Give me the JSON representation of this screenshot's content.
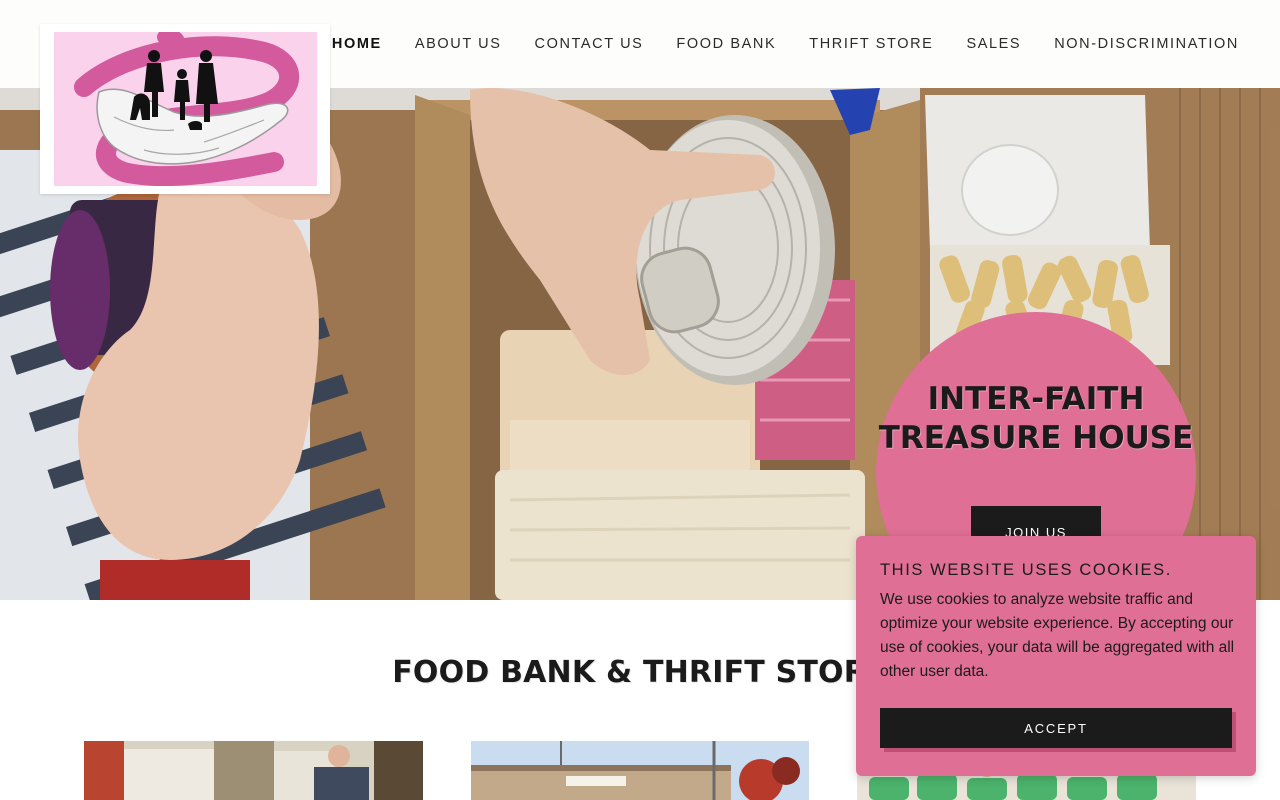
{
  "header": {
    "logo_icon": "family-in-hands-logo",
    "nav": [
      {
        "label": "HOME",
        "active": true
      },
      {
        "label": "ABOUT US",
        "active": false
      },
      {
        "label": "CONTACT US",
        "active": false
      },
      {
        "label": "FOOD BANK",
        "active": false
      },
      {
        "label": "THRIFT STORE",
        "active": false
      },
      {
        "label": "SALES",
        "active": false
      },
      {
        "label": "NON-DISCRIMINATION",
        "active": false
      }
    ]
  },
  "hero": {
    "image_subject": "children-packing-food-donation-box",
    "title": "INTER-FAITH TREASURE HOUSE",
    "cta_label": "JOIN US",
    "accent_color": "#df6f94"
  },
  "section": {
    "heading": "FOOD BANK & THRIFT STORE",
    "thumbnails": [
      {
        "subject": "volunteer-in-pantry"
      },
      {
        "subject": "storefront-building"
      },
      {
        "subject": "volunteers-group-green-shirts"
      }
    ]
  },
  "cookie_banner": {
    "title": "THIS WEBSITE USES COOKIES.",
    "body": "We use cookies to analyze website traffic and optimize your website experience. By accepting our use of cookies, your data will be aggregated with all other user data.",
    "accept_label": "ACCEPT",
    "background": "#df6f94"
  }
}
